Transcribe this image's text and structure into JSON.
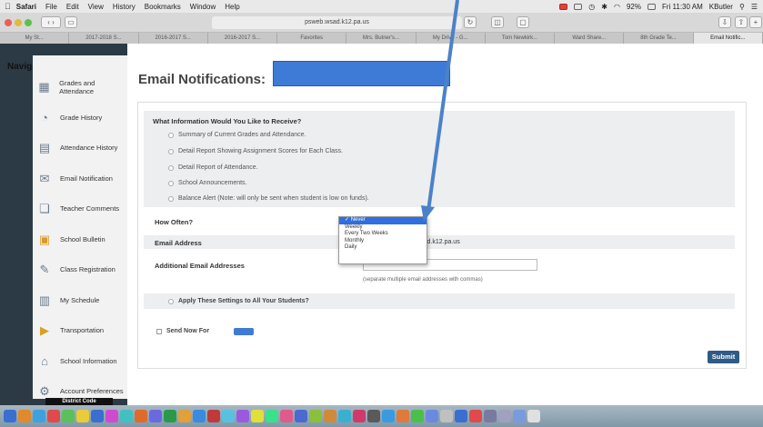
{
  "menubar": {
    "apple": "",
    "items": [
      "Safari",
      "File",
      "Edit",
      "View",
      "History",
      "Bookmarks",
      "Window",
      "Help"
    ],
    "clock": "Fri 11:30 AM",
    "user": "KButler",
    "battery": "92%"
  },
  "toolbar": {
    "url": "psweb.wsad.k12.pa.us"
  },
  "tabs": [
    "My St...",
    "2017-2018 S...",
    "2016-2017 S...",
    "2016-2017 S...",
    "Favorites",
    "Mrs. Butner's...",
    "My Drive - G...",
    "Tom Newkirk...",
    "Ward Share...",
    "8th Grade Te...",
    "Email Notific..."
  ],
  "nav": {
    "title": "Navigation",
    "items": [
      {
        "label": "Grades and Attendance",
        "icon": "grades-icon"
      },
      {
        "label": "Grade History",
        "icon": "history-icon"
      },
      {
        "label": "Attendance History",
        "icon": "attendance-icon"
      },
      {
        "label": "Email Notification",
        "icon": "email-icon"
      },
      {
        "label": "Teacher Comments",
        "icon": "comments-icon"
      },
      {
        "label": "School Bulletin",
        "icon": "bulletin-icon"
      },
      {
        "label": "Class Registration",
        "icon": "registration-icon"
      },
      {
        "label": "My Schedule",
        "icon": "schedule-icon"
      },
      {
        "label": "Transportation",
        "icon": "transport-icon"
      },
      {
        "label": "School Information",
        "icon": "school-icon"
      },
      {
        "label": "Account Preferences",
        "icon": "preferences-icon"
      }
    ],
    "district": "District Code"
  },
  "page": {
    "title": "Email Notifications: "
  },
  "form": {
    "question": "What Information Would You Like to Receive?",
    "options": [
      "Summary of Current Grades and Attendance.",
      "Detail Report Showing Assignment Scores for Each Class.",
      "Detail Report of Attendance.",
      "School Announcements.",
      "Balance Alert (Note: will only be sent when student is low on funds)."
    ],
    "how_often": "How Often?",
    "frequencies": [
      "Never",
      "Weekly",
      "Every Two Weeks",
      "Monthly",
      "Daily"
    ],
    "email_label": "Email Address",
    "email_value": "sd.k12.pa.us",
    "additional_label": "Additional Email Addresses",
    "additional_hint": "(separate multiple email addresses with commas)",
    "apply_all": "Apply These Settings to All Your Students?",
    "send_now": "Send Now For",
    "submit": "Submit"
  },
  "colors": {
    "accent": "#3e7bd6",
    "sidebar": "#2c3a46",
    "submit": "#2f5b86"
  }
}
